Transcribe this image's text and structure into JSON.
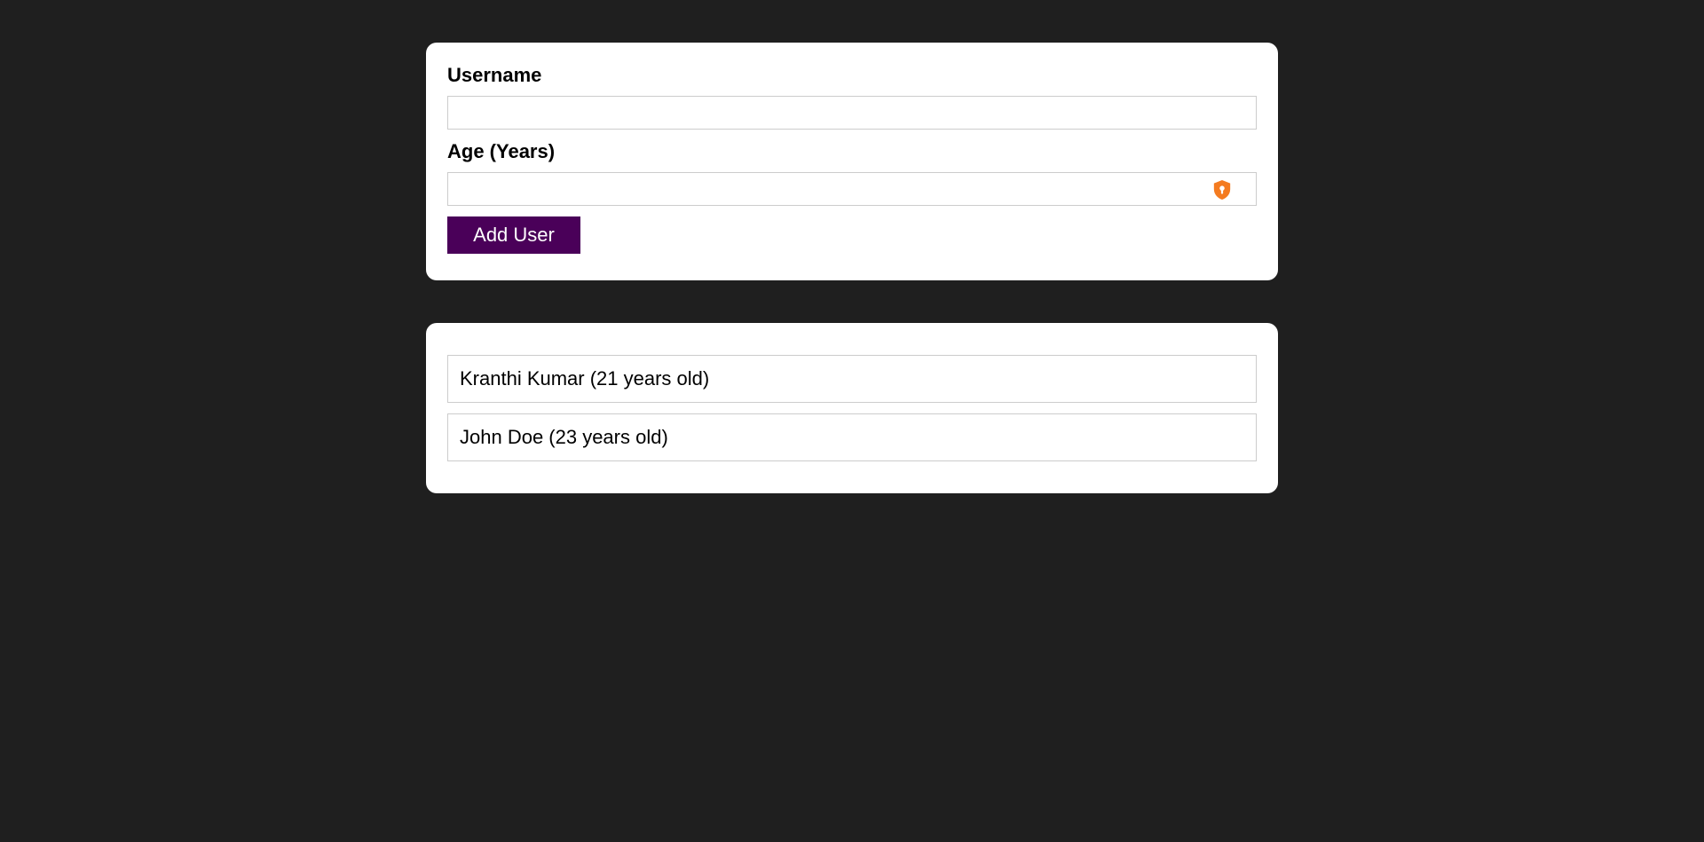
{
  "form": {
    "username_label": "Username",
    "username_value": "",
    "age_label": "Age (Years)",
    "age_value": "",
    "password_manager_icon": "shield-lock-icon",
    "submit_label": "Add User"
  },
  "users": [
    {
      "text": "Kranthi Kumar (21 years old)"
    },
    {
      "text": "John Doe (23 years old)"
    }
  ],
  "colors": {
    "background": "#1f1f1f",
    "card": "#ffffff",
    "button": "#4a0059",
    "shield_icon": "#f47b20"
  }
}
